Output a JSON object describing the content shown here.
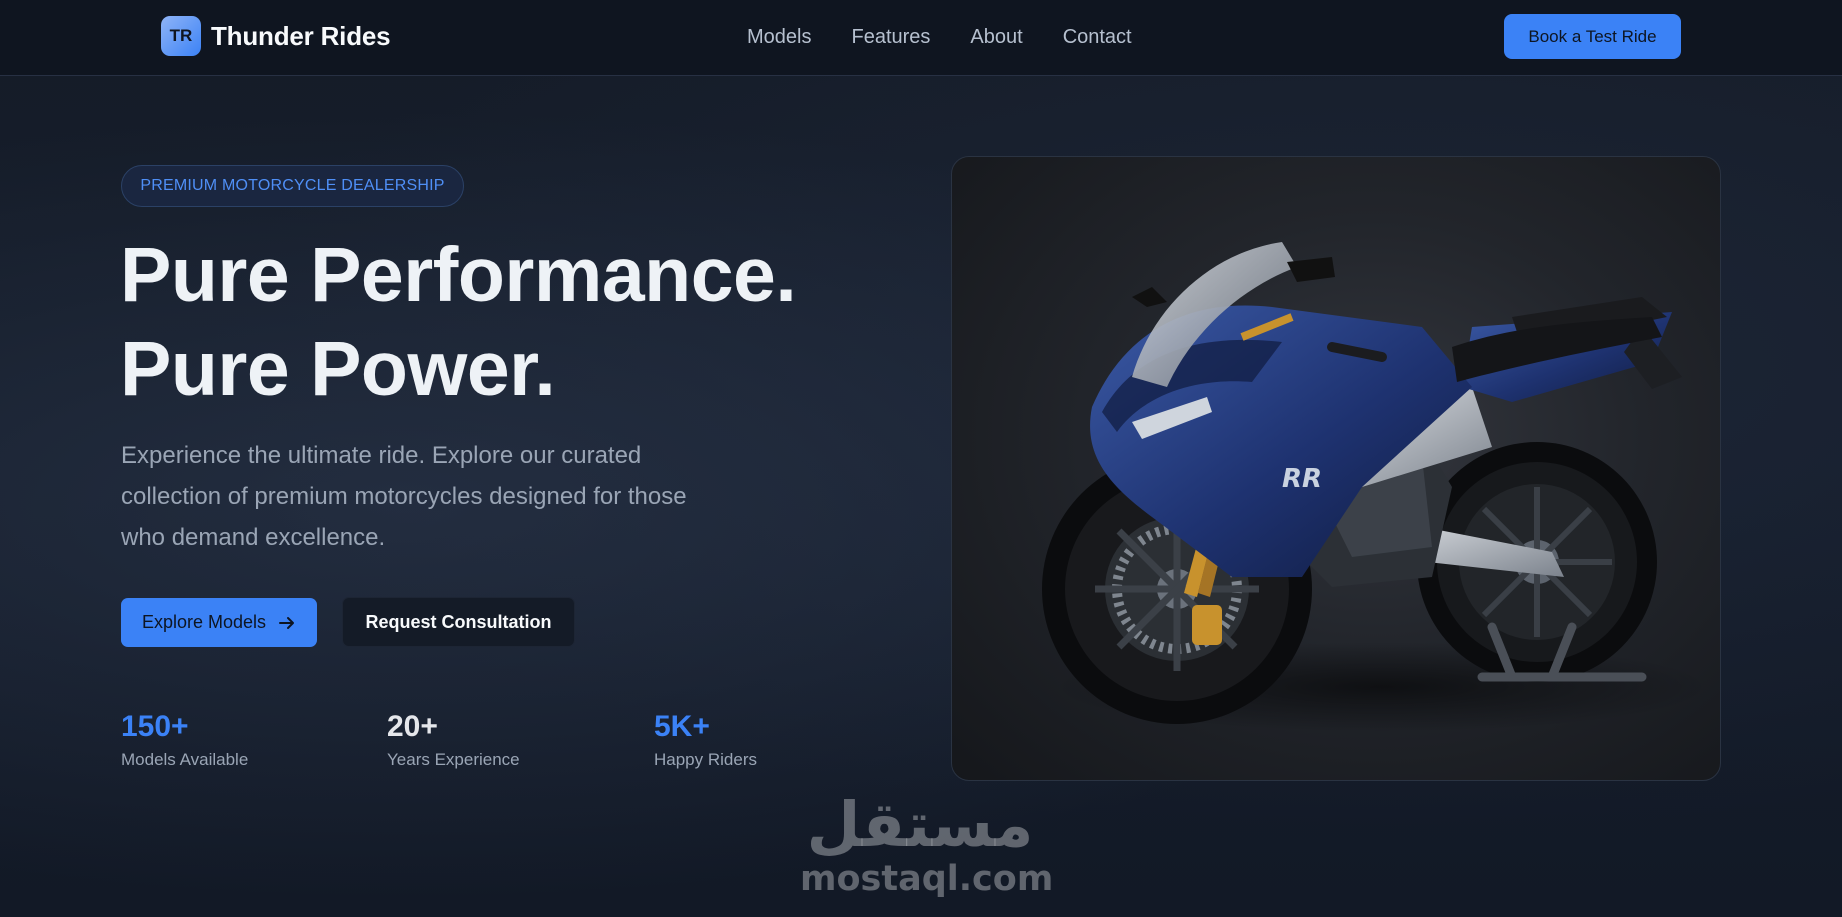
{
  "header": {
    "brand_initials": "TR",
    "brand_name": "Thunder Rides",
    "nav": [
      "Models",
      "Features",
      "About",
      "Contact"
    ],
    "cta_label": "Book a Test Ride"
  },
  "hero": {
    "badge": "PREMIUM MOTORCYCLE DEALERSHIP",
    "headline_line1": "Pure Performance.",
    "headline_line2": "Pure Power.",
    "description": "Experience the ultimate ride. Explore our curated collection of premium motorcycles designed for those who demand excellence.",
    "primary_button": "Explore Models",
    "primary_button_icon": "arrow-right-icon",
    "secondary_button": "Request Consultation",
    "stats": [
      {
        "value": "150+",
        "label": "Models Available",
        "color": "#3b82f6"
      },
      {
        "value": "20+",
        "label": "Years Experience",
        "color": "#e5e7eb"
      },
      {
        "value": "5K+",
        "label": "Happy Riders",
        "color": "#3b82f6"
      }
    ],
    "image_fairing_text": "RR"
  },
  "watermark": {
    "arabic": "مستقل",
    "latin": "mostaql.com"
  },
  "colors": {
    "accent": "#3b82f6",
    "background": "#131a26",
    "header_bg": "#0f1520"
  }
}
